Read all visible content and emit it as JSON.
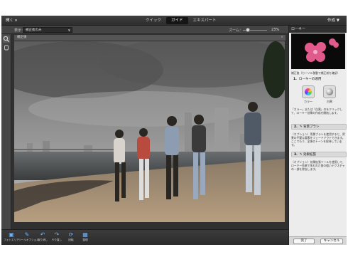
{
  "menubar": {
    "open_label": "開く",
    "mode_tabs": [
      "クイック",
      "ガイド",
      "エキスパート"
    ],
    "active_tab": "ガイド",
    "create_label": "作成"
  },
  "options": {
    "view_label": "表示：",
    "view_value": "補正後のみ",
    "zoom_label": "ズーム：",
    "zoom_value": "23%"
  },
  "document": {
    "tab_title": "補正後",
    "close_glyph": "×"
  },
  "panel": {
    "title": "ローキー",
    "subtitle": "補正後（カーソル移動で補正前を確認）",
    "step1_num": "1.",
    "step1_label": "ローキーの適用",
    "swatch_color_label": "カラー",
    "swatch_white_label": "白黒",
    "desc1": "「カラー」または「白黒」のをクリックして、ローキー効果の作成を開始します。",
    "step2_num": "2.",
    "step2_label": "背景ブラシ",
    "desc2": "（オプション）背景ブラシを使用すると、背景の不要な要素をフェードアウトできます。ここでもう、全体のトーンを保持しています。",
    "step3_num": "3.",
    "step3_label": "効果拡張",
    "desc3": "（オプション）効果拡張ツールを使用して、ローキー効果で失われた前の粗いテクスチャの一部を除去します。",
    "done_label": "完了",
    "cancel_label": "キャンセル"
  },
  "bottom": {
    "items": [
      {
        "label": "フォトエリア",
        "icon": "photo-bin-icon"
      },
      {
        "label": "ツールオプション",
        "icon": "tool-options-icon"
      },
      {
        "label": "取り消し",
        "icon": "undo-icon"
      },
      {
        "label": "やり直し",
        "icon": "redo-icon"
      },
      {
        "label": "回転",
        "icon": "rotate-icon"
      },
      {
        "label": "整理",
        "icon": "organizer-icon"
      }
    ]
  },
  "colors": {
    "active_tab": "#151515",
    "accent_icon": "#6ab0ff",
    "panel_bg": "#ececec"
  }
}
